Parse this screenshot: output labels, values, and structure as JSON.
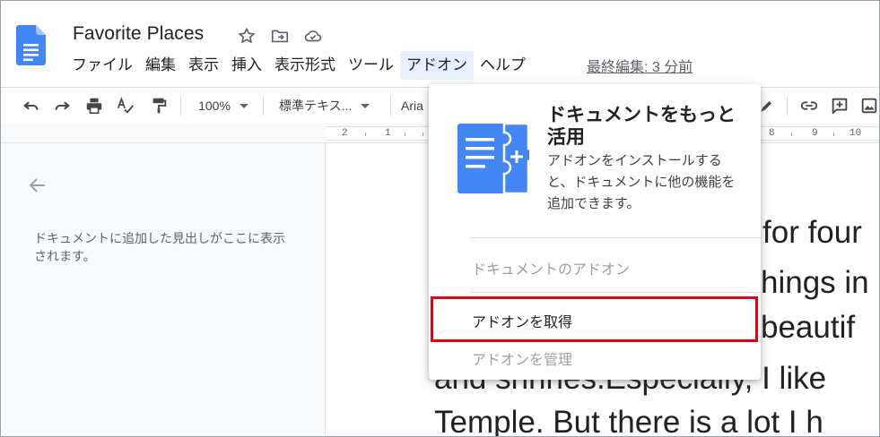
{
  "header": {
    "title": "Favorite Places",
    "last_edit": "最終編集: 3 分前",
    "colors": {
      "docs_blue": "#4285f4",
      "icon_gray": "#5f6368"
    }
  },
  "menubar": {
    "items": [
      {
        "label": "ファイル"
      },
      {
        "label": "編集"
      },
      {
        "label": "表示"
      },
      {
        "label": "挿入"
      },
      {
        "label": "表示形式"
      },
      {
        "label": "ツール"
      },
      {
        "label": "アドオン",
        "active": true
      },
      {
        "label": "ヘルプ"
      }
    ]
  },
  "toolbar": {
    "zoom": "100%",
    "style": "標準テキス...",
    "font": "Aria"
  },
  "ruler": {
    "numbers": [
      "2",
      "1",
      "8",
      "9",
      "10"
    ]
  },
  "outline": {
    "hint": "ドキュメントに追加した見出しがここに表示されます。"
  },
  "document": {
    "lines": [
      "for four",
      "hings in",
      "beautif",
      "and shrines.Especially, I like",
      "Temple. But there is a lot I h"
    ]
  },
  "addon_menu": {
    "promo_title": "ドキュメントをもっと活用",
    "promo_desc": "アドオンをインストールすると、ドキュメントに他の機能を追加できます。",
    "items": [
      {
        "label": "ドキュメントのアドオン",
        "enabled": false
      },
      {
        "label": "アドオンを取得",
        "enabled": true,
        "highlighted": true
      },
      {
        "label": "アドオンを管理",
        "enabled": false
      }
    ],
    "highlight_color": "#e00012"
  }
}
